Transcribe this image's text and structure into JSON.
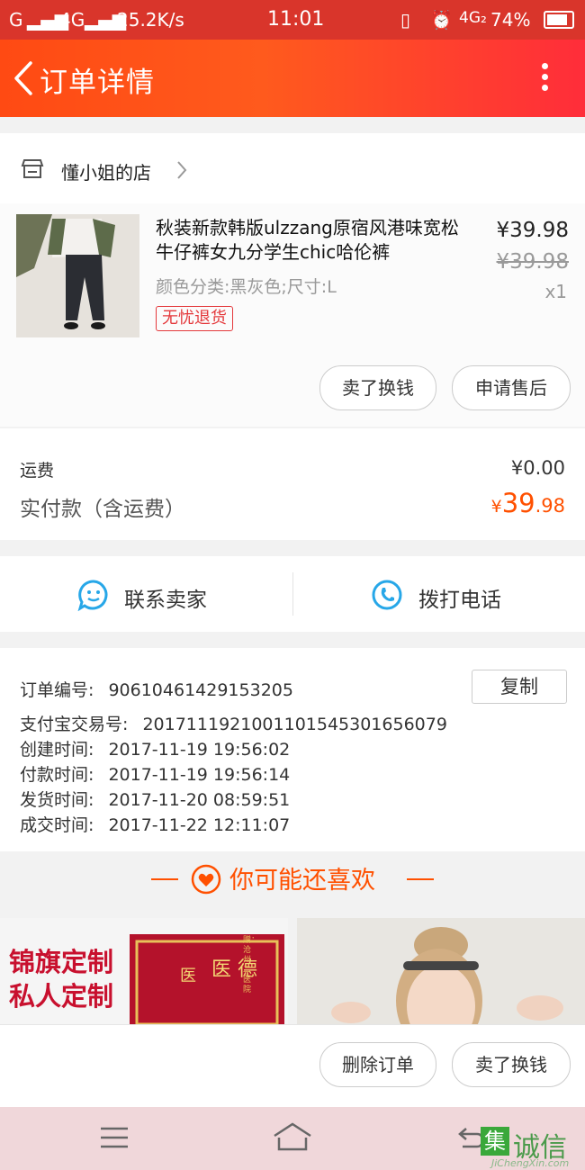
{
  "status_bar": {
    "network_left": "G",
    "network_4g": "4G",
    "speed": "25.2K/s",
    "time": "11:01",
    "network_right": "4G₂",
    "battery": "74%"
  },
  "header": {
    "title": "订单详情"
  },
  "shop": {
    "name": "懂小姐的店"
  },
  "product": {
    "title": "秋装新款韩版ulzzang原宿风港味宽松牛仔裤女九分学生chic哈伦裤",
    "spec": "颜色分类:黑灰色;尺寸:L",
    "badge": "无忧退货",
    "price": "¥39.98",
    "original_price": "¥39.98",
    "quantity": "x1",
    "actions": [
      "卖了换钱",
      "申请售后"
    ]
  },
  "cost": {
    "shipping_label": "运费",
    "shipping_value": "¥0.00",
    "paid_label": "实付款（含运费）",
    "paid_symbol": "¥",
    "paid_int": "39",
    "paid_dec": ".98"
  },
  "contact": {
    "seller": "联系卖家",
    "call": "拨打电话"
  },
  "order_info": {
    "order_no_label": "订单编号:",
    "order_no": "90610461429153205",
    "copy": "复制",
    "alipay_label": "支付宝交易号:",
    "alipay_no": "2017111921001101545301656079",
    "created_label": "创建时间:",
    "created": "2017-11-19 19:56:02",
    "paid_label": "付款时间:",
    "paid": "2017-11-19 19:56:14",
    "shipped_label": "发货时间:",
    "shipped": "2017-11-20 08:59:51",
    "done_label": "成交时间:",
    "done": "2017-11-22 12:11:07"
  },
  "recommend": {
    "title": "你可能还喜欢",
    "left_banner_line1": "锦旗定制",
    "left_banner_line2": "私人定制",
    "banner_flag_text": "赠：沧州二医院"
  },
  "bottom_actions": [
    "删除订单",
    "卖了换钱"
  ],
  "watermark": {
    "brand": "集诚信",
    "url": "JiChengXin.com"
  },
  "colors": {
    "accent": "#ff5000",
    "header": "#ff3b1f",
    "badge_red": "#e4393c",
    "icon_blue": "#27a7e8"
  }
}
